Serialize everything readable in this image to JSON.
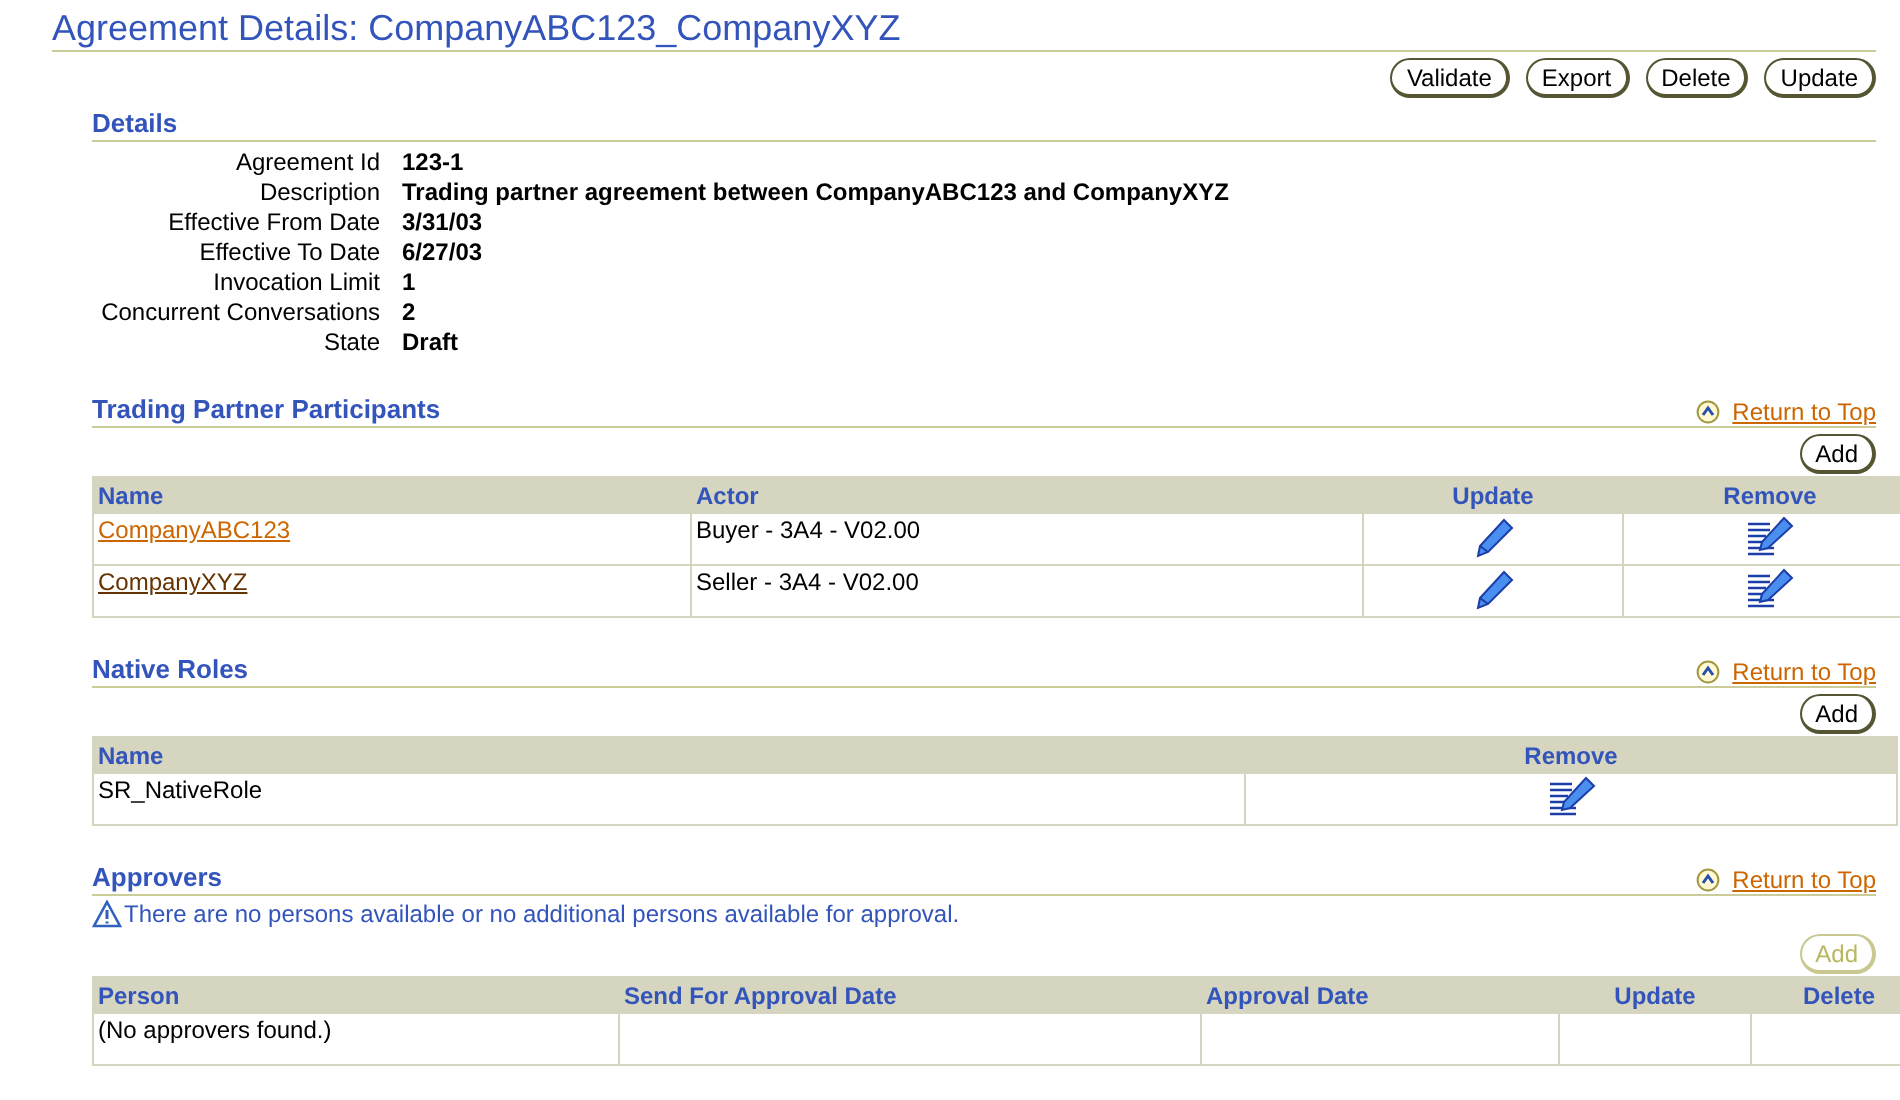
{
  "title": "Agreement Details: CompanyABC123_CompanyXYZ",
  "page_buttons": [
    {
      "label": "Validate",
      "disabled": false
    },
    {
      "label": "Export",
      "disabled": false
    },
    {
      "label": "Delete",
      "disabled": false
    },
    {
      "label": "Update",
      "disabled": false
    }
  ],
  "details": {
    "heading": "Details",
    "fields": [
      {
        "label": "Agreement Id",
        "value": "123-1"
      },
      {
        "label": "Description",
        "value": "Trading partner agreement between CompanyABC123 and CompanyXYZ"
      },
      {
        "label": "Effective From Date",
        "value": "3/31/03"
      },
      {
        "label": "Effective To Date",
        "value": "6/27/03"
      },
      {
        "label": "Invocation Limit",
        "value": "1"
      },
      {
        "label": "Concurrent Conversations",
        "value": "2"
      },
      {
        "label": "State",
        "value": "Draft"
      }
    ]
  },
  "sections": [
    {
      "heading": "Trading Partner Participants",
      "return_link": "Return to Top",
      "add_button": {
        "label": "Add",
        "disabled": false
      },
      "columns": [
        {
          "label": "Name",
          "kind": "text"
        },
        {
          "label": "Actor",
          "kind": "text"
        },
        {
          "label": "Update",
          "kind": "action"
        },
        {
          "label": "Remove",
          "kind": "action"
        }
      ],
      "rows": [
        [
          {
            "kind": "link",
            "text": "CompanyABC123",
            "visited": false
          },
          {
            "kind": "text",
            "text": "Buyer - 3A4 - V02.00"
          },
          {
            "kind": "edit"
          },
          {
            "kind": "remove"
          }
        ],
        [
          {
            "kind": "link",
            "text": "CompanyXYZ",
            "visited": true
          },
          {
            "kind": "text",
            "text": "Seller - 3A4 - V02.00"
          },
          {
            "kind": "edit"
          },
          {
            "kind": "remove"
          }
        ]
      ]
    },
    {
      "heading": "Native Roles",
      "return_link": "Return to Top",
      "add_button": {
        "label": "Add",
        "disabled": false
      },
      "columns": [
        {
          "label": "Name",
          "kind": "text"
        },
        {
          "label": "Remove",
          "kind": "action"
        }
      ],
      "rows": [
        [
          {
            "kind": "text",
            "text": "SR_NativeRole"
          },
          {
            "kind": "remove"
          }
        ]
      ]
    },
    {
      "heading": "Approvers",
      "return_link": "Return to Top",
      "message": "There are no persons available or no additional persons available for approval.",
      "add_button": {
        "label": "Add",
        "disabled": true
      },
      "columns": [
        {
          "label": "Person",
          "kind": "text"
        },
        {
          "label": "Send For Approval Date",
          "kind": "text"
        },
        {
          "label": "Approval Date",
          "kind": "text"
        },
        {
          "label": "Update",
          "kind": "action"
        },
        {
          "label": "Delete",
          "kind": "action"
        }
      ],
      "rows": [
        [
          {
            "kind": "text",
            "text": "(No approvers found.)"
          },
          {
            "kind": "empty"
          },
          {
            "kind": "empty"
          },
          {
            "kind": "empty"
          },
          {
            "kind": "empty"
          }
        ]
      ]
    }
  ]
}
